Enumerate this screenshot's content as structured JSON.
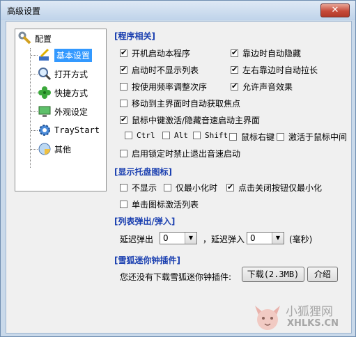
{
  "window": {
    "title": "高级设置",
    "close_label": "✕"
  },
  "tree": {
    "root": "配置",
    "items": [
      {
        "label": "基本设置",
        "icon": "pen-icon",
        "selected": true
      },
      {
        "label": "打开方式",
        "icon": "magnifier-icon"
      },
      {
        "label": "快捷方式",
        "icon": "clover-icon"
      },
      {
        "label": "外观设定",
        "icon": "monitor-icon"
      },
      {
        "label": "TrayStart",
        "icon": "gear-icon"
      },
      {
        "label": "其他",
        "icon": "disc-icon"
      }
    ]
  },
  "program": {
    "title": "[程序相关]",
    "startup": "开机启动本程序",
    "hide_list": "启动时不显示列表",
    "freq_sort": "按使用频率调整次序",
    "auto_focus": "移动到主界面时自动获取焦点",
    "edge_hide": "靠边时自动隐藏",
    "edge_stretch": "左右靠边时自动拉长",
    "sound": "允许声音效果",
    "middle_click": "鼠标中键激活/隐藏音速启动主界面",
    "ctrl": "Ctrl",
    "alt": "Alt",
    "shift": "Shift",
    "right_click": "鼠标右键",
    "activate_middle": "激活于鼠标中间",
    "lock_disable": "启用锁定时禁止退出音速启动"
  },
  "tray": {
    "title": "[显示托盘图标]",
    "hide": "不显示",
    "min_only": "仅最小化时",
    "close_min": "点击关闭按钮仅最小化",
    "single_click": "单击图标激活列表"
  },
  "popup": {
    "title": "[列表弹出/弹入]",
    "delay_out": "延迟弹出",
    "delay_out_value": "0",
    "delay_in": "，延迟弹入",
    "delay_in_value": "0",
    "unit": "(毫秒)"
  },
  "plugin": {
    "title": "[雪狐迷你钟插件]",
    "message": "您还没有下载雪狐迷你钟插件:",
    "download": "下载(2.3MB)",
    "intro": "介绍"
  },
  "watermark": {
    "cn": "小狐狸网",
    "en": "XHLKS.CN"
  }
}
